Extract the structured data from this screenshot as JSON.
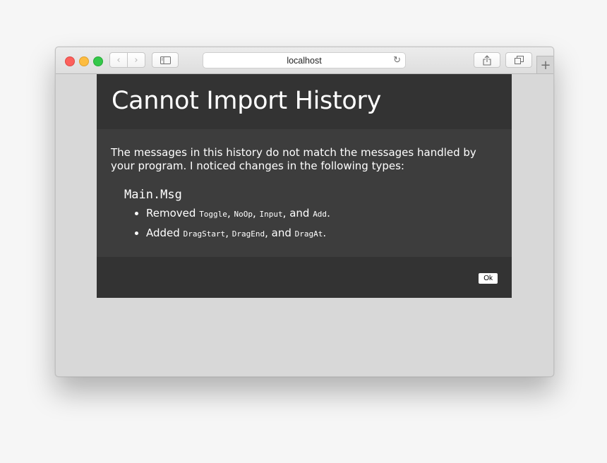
{
  "browser": {
    "address": "localhost",
    "icons": {
      "back": "chevron-left-icon",
      "forward": "chevron-right-icon",
      "sidebar": "sidebar-icon",
      "reload": "reload-icon",
      "share": "share-icon",
      "tabs": "tabs-icon",
      "new_tab": "plus-icon"
    },
    "glyphs": {
      "back": "‹",
      "forward": "›",
      "reload": "↻",
      "new_tab": "+"
    }
  },
  "dialog": {
    "title": "Cannot Import History",
    "message": "The messages in this history do not match the messages handled by your program. I noticed changes in the following types:",
    "module": "Main.Msg",
    "removed": {
      "label": "Removed",
      "items": [
        "Toggle",
        "NoOp",
        "Input",
        "Add"
      ],
      "sep": ", ",
      "conj": ", and ",
      "end": "."
    },
    "added": {
      "label": "Added",
      "items": [
        "DragStart",
        "DragEnd",
        "DragAt"
      ],
      "sep": ", ",
      "conj": ", and ",
      "end": "."
    },
    "ok_label": "Ok"
  },
  "colors": {
    "header_bg": "#333333",
    "body_bg": "#3d3d3d",
    "page_bg": "#d8d8d8"
  }
}
